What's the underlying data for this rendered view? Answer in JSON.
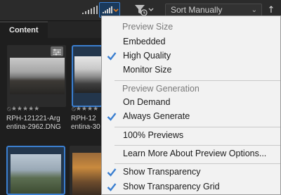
{
  "toolbar": {
    "sort_label": "Sort Manually",
    "icons": [
      "thumbnail-size-icon",
      "preview-options-icon",
      "filter-icon",
      "sort-order-icon"
    ],
    "accent": "#3b7fd0"
  },
  "panel": {
    "tab_label": "Content"
  },
  "thumbnails": [
    {
      "rating": "⦸★★★★★",
      "filename_line1": "RPH-121221-Arg",
      "filename_line2": "entina-2962.DNG"
    },
    {
      "rating": "⦸★★★★",
      "filename_line1": "RPH-12",
      "filename_line2": "entina-30"
    }
  ],
  "menu": {
    "preview_size_header": "Preview Size",
    "embedded": "Embedded",
    "high_quality": "High Quality",
    "monitor_size": "Monitor Size",
    "preview_generation_header": "Preview Generation",
    "on_demand": "On Demand",
    "always_generate": "Always Generate",
    "previews_100": "100% Previews",
    "learn_more": "Learn More About Preview Options...",
    "show_transparency": "Show Transparency",
    "show_transparency_grid": "Show Transparency Grid"
  }
}
